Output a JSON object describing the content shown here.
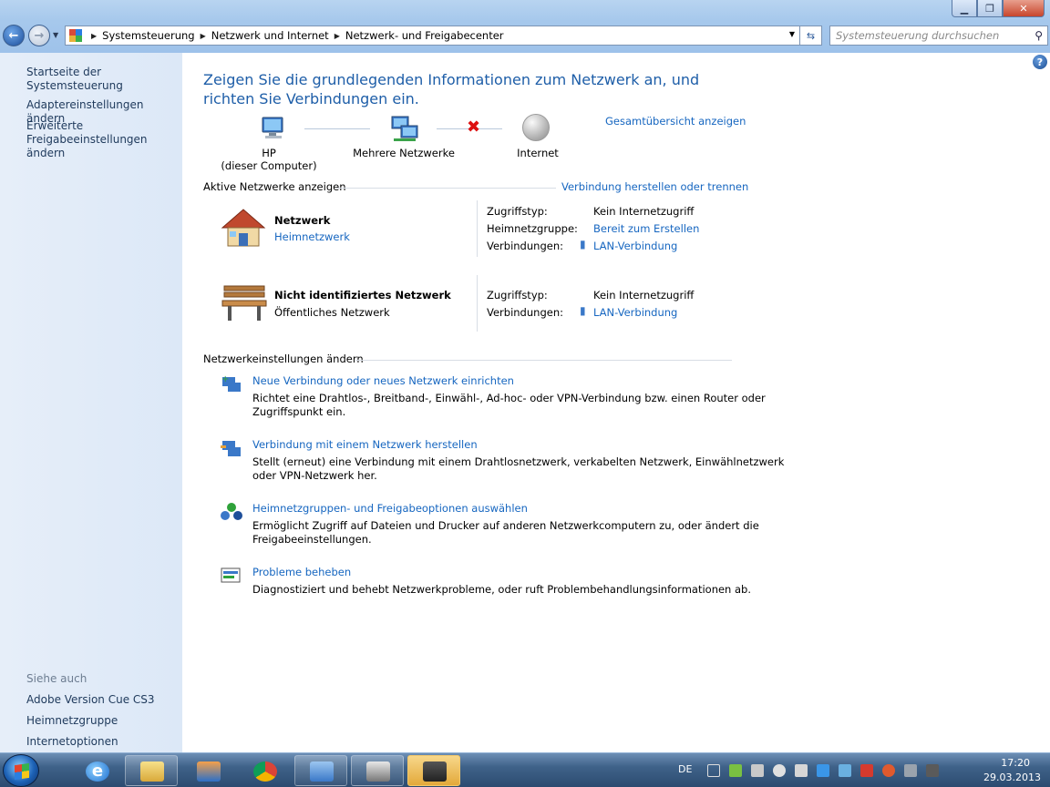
{
  "addressbar": {
    "crumbs": [
      "Systemsteuerung",
      "Netzwerk und Internet",
      "Netzwerk- und Freigabecenter"
    ],
    "search_placeholder": "Systemsteuerung durchsuchen"
  },
  "sidebar": {
    "home": "Startseite der Systemsteuerung",
    "adapter": "Adaptereinstellungen ändern",
    "sharing_line1": "Erweiterte",
    "sharing_line2": "Freigabeeinstellungen ändern",
    "see_also": "Siehe auch",
    "see_also_items": [
      "Adobe Version Cue CS3",
      "Heimnetzgruppe",
      "Internetoptionen"
    ]
  },
  "main": {
    "heading": "Zeigen Sie die grundlegenden Informationen zum Netzwerk an, und richten Sie Verbindungen ein.",
    "map": {
      "computer_name": "HP",
      "computer_sub": "(dieser Computer)",
      "networks": "Mehrere Netzwerke",
      "internet": "Internet",
      "full_map": "Gesamtübersicht anzeigen"
    },
    "active_header": "Aktive Netzwerke anzeigen",
    "connect_link": "Verbindung herstellen oder trennen",
    "networks": [
      {
        "name": "Netzwerk",
        "type": "Heimnetzwerk",
        "access_label": "Zugriffstyp:",
        "access_value": "Kein Internetzugriff",
        "homegroup_label": "Heimnetzgruppe:",
        "homegroup_value": "Bereit zum Erstellen",
        "conn_label": "Verbindungen:",
        "conn_value": "LAN-Verbindung"
      },
      {
        "name": "Nicht identifiziertes Netzwerk",
        "type": "Öffentliches Netzwerk",
        "access_label": "Zugriffstyp:",
        "access_value": "Kein Internetzugriff",
        "conn_label": "Verbindungen:",
        "conn_value": "LAN-Verbindung"
      }
    ],
    "settings_header": "Netzwerkeinstellungen ändern",
    "tasks": [
      {
        "title": "Neue Verbindung oder neues Netzwerk einrichten",
        "desc1": "Richtet eine Drahtlos-, Breitband-, Einwähl-, Ad-hoc- oder VPN-Verbindung bzw. einen Router oder",
        "desc2": "Zugriffspunkt ein."
      },
      {
        "title": "Verbindung mit einem Netzwerk herstellen",
        "desc1": "Stellt (erneut) eine Verbindung mit einem Drahtlosnetzwerk, verkabelten Netzwerk, Einwählnetzwerk",
        "desc2": "oder VPN-Netzwerk her."
      },
      {
        "title": "Heimnetzgruppen- und Freigabeoptionen auswählen",
        "desc1": "Ermöglicht Zugriff auf Dateien und Drucker auf anderen Netzwerkcomputern zu, oder ändert die",
        "desc2": "Freigabeeinstellungen."
      },
      {
        "title": "Probleme beheben",
        "desc1": "Diagnostiziert und behebt Netzwerkprobleme, oder ruft Problembehandlungsinformationen ab.",
        "desc2": ""
      }
    ]
  },
  "taskbar": {
    "lang": "DE",
    "time": "17:20",
    "date": "29.03.2013"
  }
}
